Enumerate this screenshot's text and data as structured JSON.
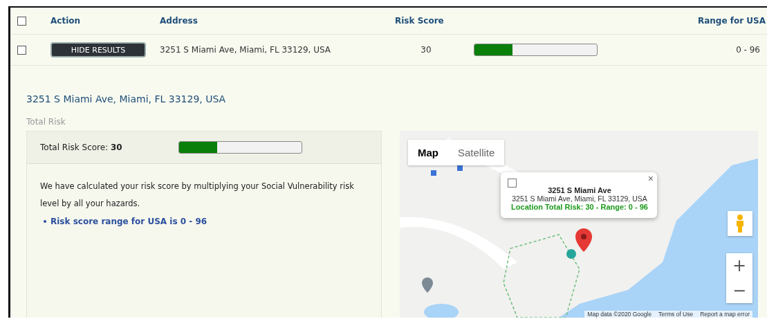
{
  "table": {
    "select_all": {
      "checked": false
    },
    "columns": [
      "Action",
      "Address",
      "Risk Score",
      "Range for USA"
    ],
    "rows": [
      {
        "checked": false,
        "action": "HIDE RESULTS",
        "address": "3251 S Miami Ave, Miami, FL 33129, USA",
        "risk_score": "30",
        "level": 0.31,
        "range": "0 - 96"
      }
    ]
  },
  "details": {
    "title": "3251 S Miami Ave, Miami, FL 33129, USA",
    "section": "Total Risk",
    "score_label": "Total Risk Score: **30**",
    "level": 0.31,
    "description": "We have calculated your risk score by multiplying your Social Vulnerability risk level by all your hazards.",
    "bullets": [
      "Risk score range for USA is 0 - 96"
    ]
  },
  "map": {
    "types": [
      {
        "label": "Map",
        "selected": true
      },
      {
        "label": "Satellite",
        "selected": false
      }
    ],
    "popup": {
      "checked": false,
      "close": "×",
      "title": "3251 S Miami Ave",
      "address": "3251 S Miami Ave, Miami, FL 33129, USA",
      "risk": "Location Total Risk: 30 - Range: 0 - 96"
    },
    "zoom_in": "+",
    "zoom_out": "−",
    "footer": [
      "Map data ©2020 Google",
      "Terms of Use",
      "Report a map error"
    ]
  }
}
